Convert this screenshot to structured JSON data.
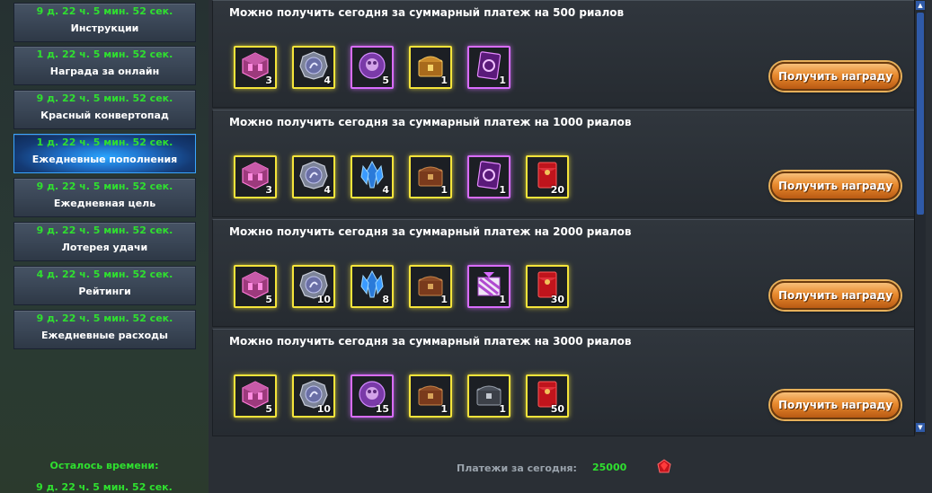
{
  "sidebar": {
    "items": [
      {
        "timer": "9 д. 22 ч. 5 мин. 52 сек.",
        "label": "Инструкции"
      },
      {
        "timer": "1 д. 22 ч. 5 мин. 52 сек.",
        "label": "Награда за онлайн"
      },
      {
        "timer": "9 д. 22 ч. 5 мин. 52 сек.",
        "label": "Красный конвертопад"
      },
      {
        "timer": "1 д. 22 ч. 5 мин. 52 сек.",
        "label": "Ежедневные пополнения",
        "active": true
      },
      {
        "timer": "9 д. 22 ч. 5 мин. 52 сек.",
        "label": "Ежедневная цель"
      },
      {
        "timer": "9 д. 22 ч. 5 мин. 52 сек.",
        "label": "Лотерея удачи"
      },
      {
        "timer": "4 д. 22 ч. 5 мин. 52 сек.",
        "label": "Рейтинги"
      },
      {
        "timer": "9 д. 22 ч. 5 мин. 52 сек.",
        "label": "Ежедневные расходы"
      }
    ],
    "remaining_label": "Осталось времени:",
    "remaining_value": "9 д. 22 ч. 5 мин. 52 сек."
  },
  "rewards": [
    {
      "title": "Можно получить сегодня за суммарный платеж на 500 риалов",
      "button": "Получить награду",
      "items": [
        {
          "icon": "pink-cube-icon",
          "qty": "3"
        },
        {
          "icon": "silver-coin-icon",
          "qty": "4"
        },
        {
          "icon": "purple-orb-icon",
          "qty": "5"
        },
        {
          "icon": "golden-chest-icon",
          "qty": "1"
        },
        {
          "icon": "purple-card-icon",
          "qty": "1"
        }
      ]
    },
    {
      "title": "Можно получить сегодня за суммарный платеж на 1000 риалов",
      "button": "Получить награду",
      "items": [
        {
          "icon": "pink-cube-icon",
          "qty": "3"
        },
        {
          "icon": "silver-coin-icon",
          "qty": "4"
        },
        {
          "icon": "blue-crystal-icon",
          "qty": "4"
        },
        {
          "icon": "brown-chest-icon",
          "qty": "1"
        },
        {
          "icon": "purple-card-icon",
          "qty": "1"
        },
        {
          "icon": "red-envelope-icon",
          "qty": "20"
        }
      ]
    },
    {
      "title": "Можно получить сегодня за суммарный платеж на 2000 риалов",
      "button": "Получить награду",
      "items": [
        {
          "icon": "pink-cube-icon",
          "qty": "5"
        },
        {
          "icon": "silver-coin-icon",
          "qty": "10"
        },
        {
          "icon": "blue-crystal-icon",
          "qty": "8"
        },
        {
          "icon": "brown-chest-icon",
          "qty": "1"
        },
        {
          "icon": "striped-gift-icon",
          "qty": "1"
        },
        {
          "icon": "red-envelope-icon",
          "qty": "30"
        }
      ]
    },
    {
      "title": "Можно получить сегодня за суммарный платеж на 3000 риалов",
      "button": "Получить награду",
      "items": [
        {
          "icon": "pink-cube-icon",
          "qty": "5"
        },
        {
          "icon": "silver-coin-icon",
          "qty": "10"
        },
        {
          "icon": "purple-orb-icon",
          "qty": "15"
        },
        {
          "icon": "brown-chest-icon",
          "qty": "1"
        },
        {
          "icon": "steel-chest-icon",
          "qty": "1"
        },
        {
          "icon": "red-envelope-icon",
          "qty": "50"
        }
      ]
    }
  ],
  "footer": {
    "payments_label": "Платежи за сегодня:",
    "payments_value": "25000",
    "currency_icon": "ruby-gem-icon"
  },
  "colors": {
    "timer": "#2fe02f",
    "active_tab": "#1f6fc7",
    "item_frame_gold": "#f5e43a",
    "item_frame_purple": "#d96cff",
    "button": "#e88a2e"
  }
}
